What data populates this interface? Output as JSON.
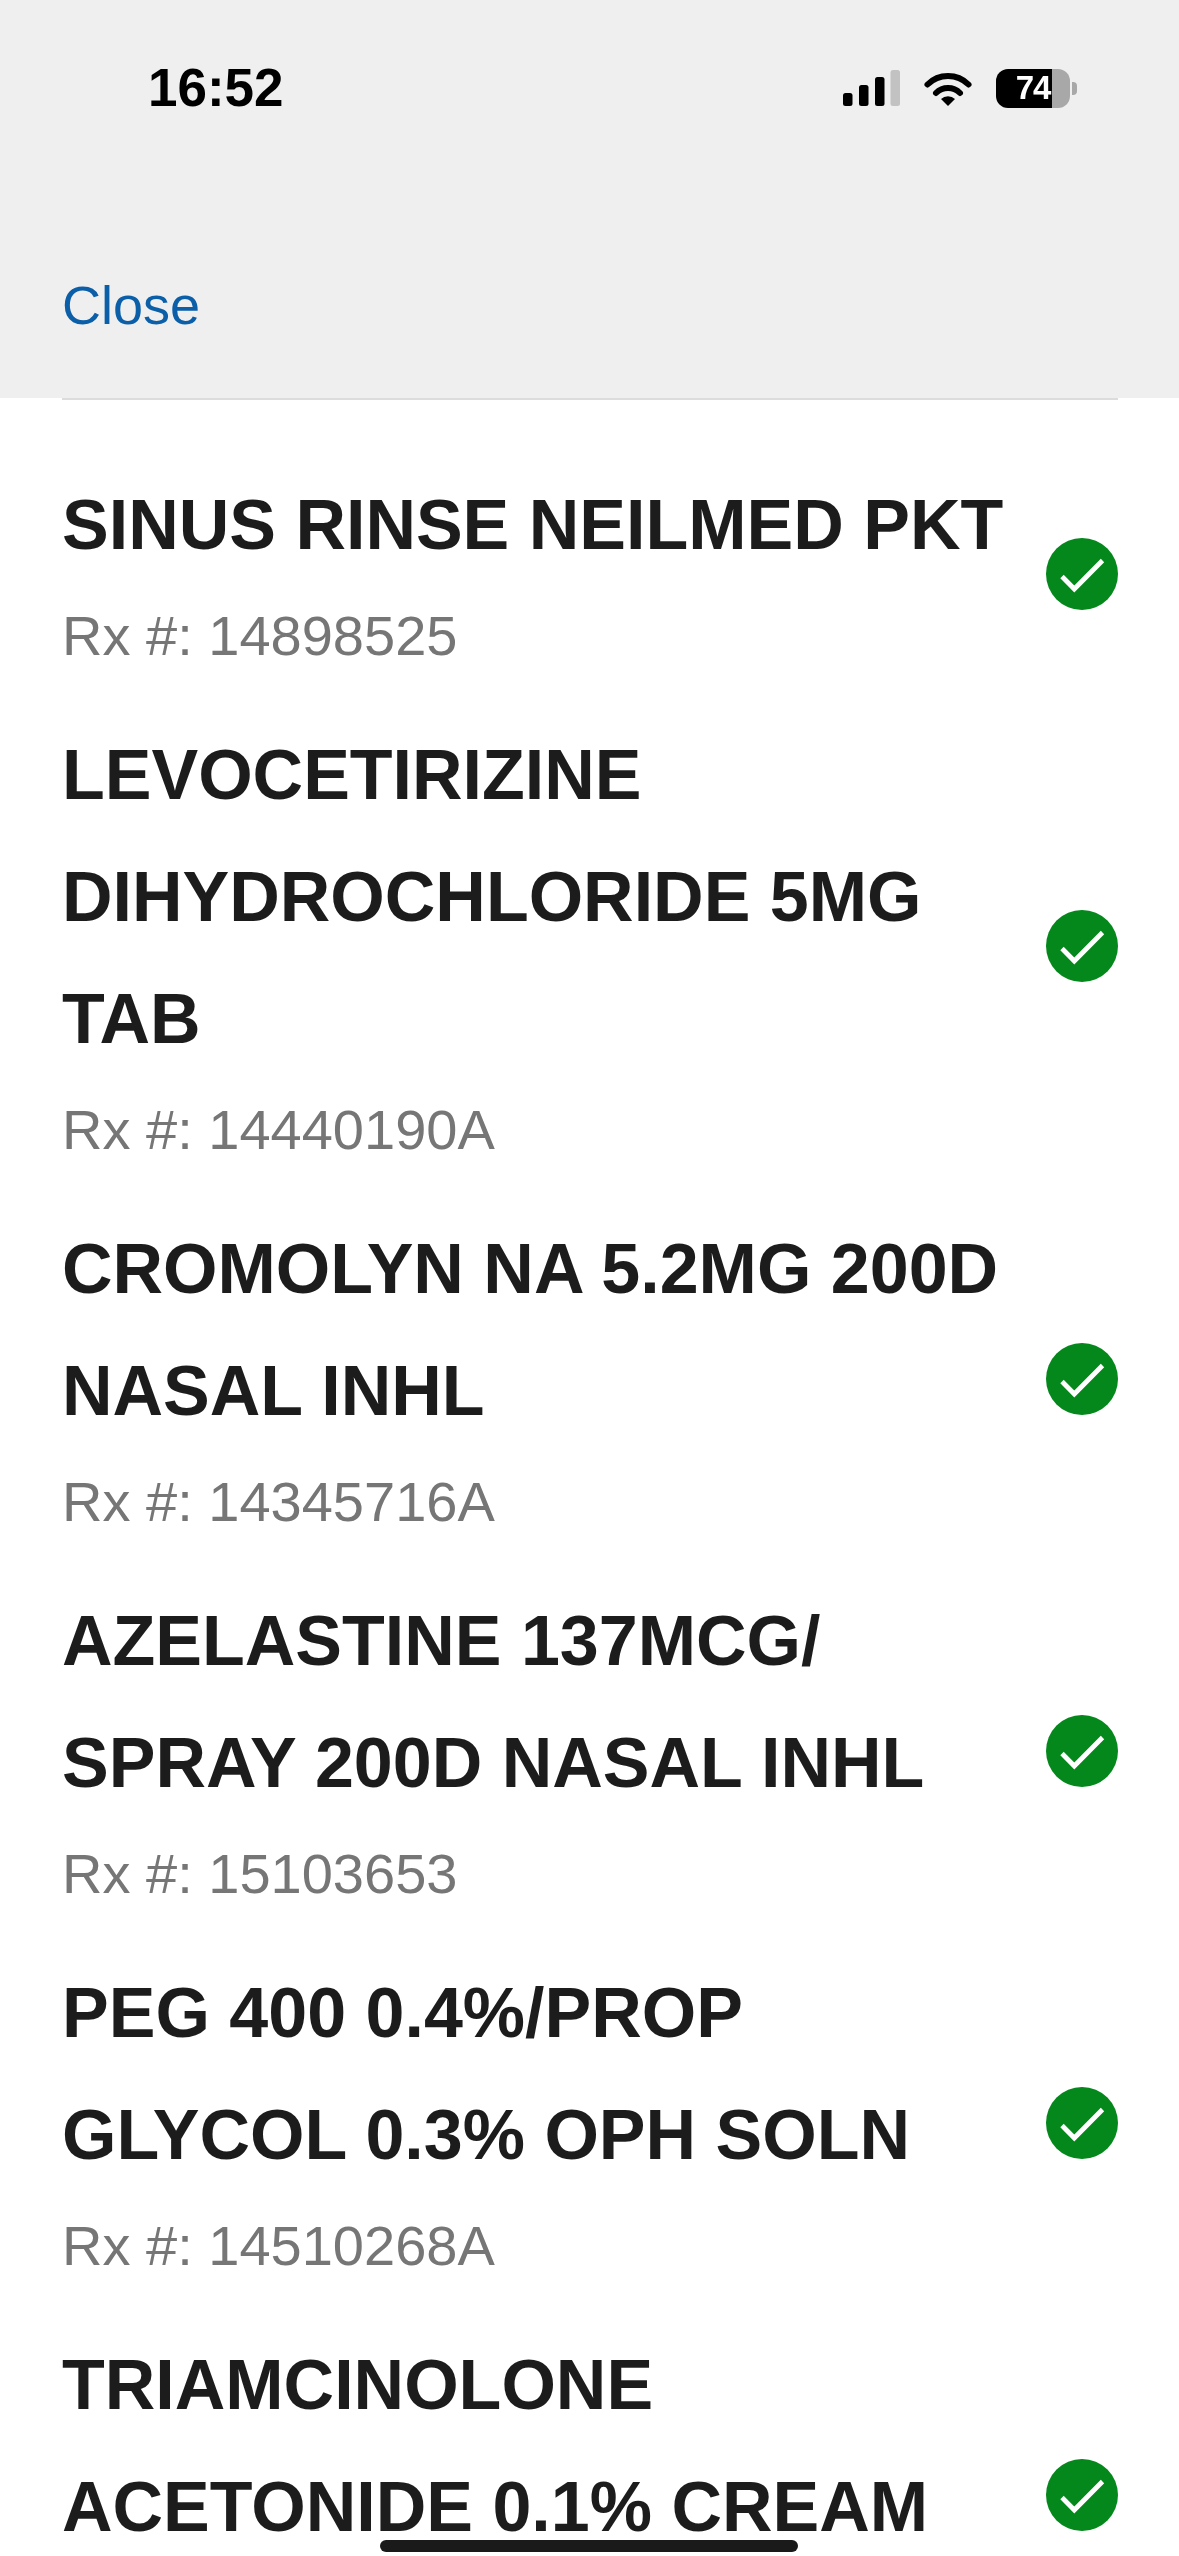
{
  "status_bar": {
    "time": "16:52",
    "battery_text": "74"
  },
  "header": {
    "close_label": "Close"
  },
  "prescriptions": [
    {
      "name": "SINUS RINSE NEILMED PKT",
      "rx_number": "Rx #: 14898525",
      "checked": true
    },
    {
      "name": "LEVOCETIRIZINE DIHYDROCHLORIDE 5MG TAB",
      "rx_number": "Rx #: 14440190A",
      "checked": true
    },
    {
      "name": "CROMOLYN NA 5.2MG 200D NASAL INHL",
      "rx_number": "Rx #: 14345716A",
      "checked": true
    },
    {
      "name": "AZELASTINE 137MCG/SPRAY 200D NASAL INHL",
      "rx_number": "Rx #: 15103653",
      "checked": true
    },
    {
      "name": "PEG 400 0.4%/PROP GLYCOL 0.3% OPH SOLN",
      "rx_number": "Rx #: 14510268A",
      "checked": true
    },
    {
      "name": "TRIAMCINOLONE ACETONIDE 0.1% CREAM",
      "checked": true
    }
  ]
}
